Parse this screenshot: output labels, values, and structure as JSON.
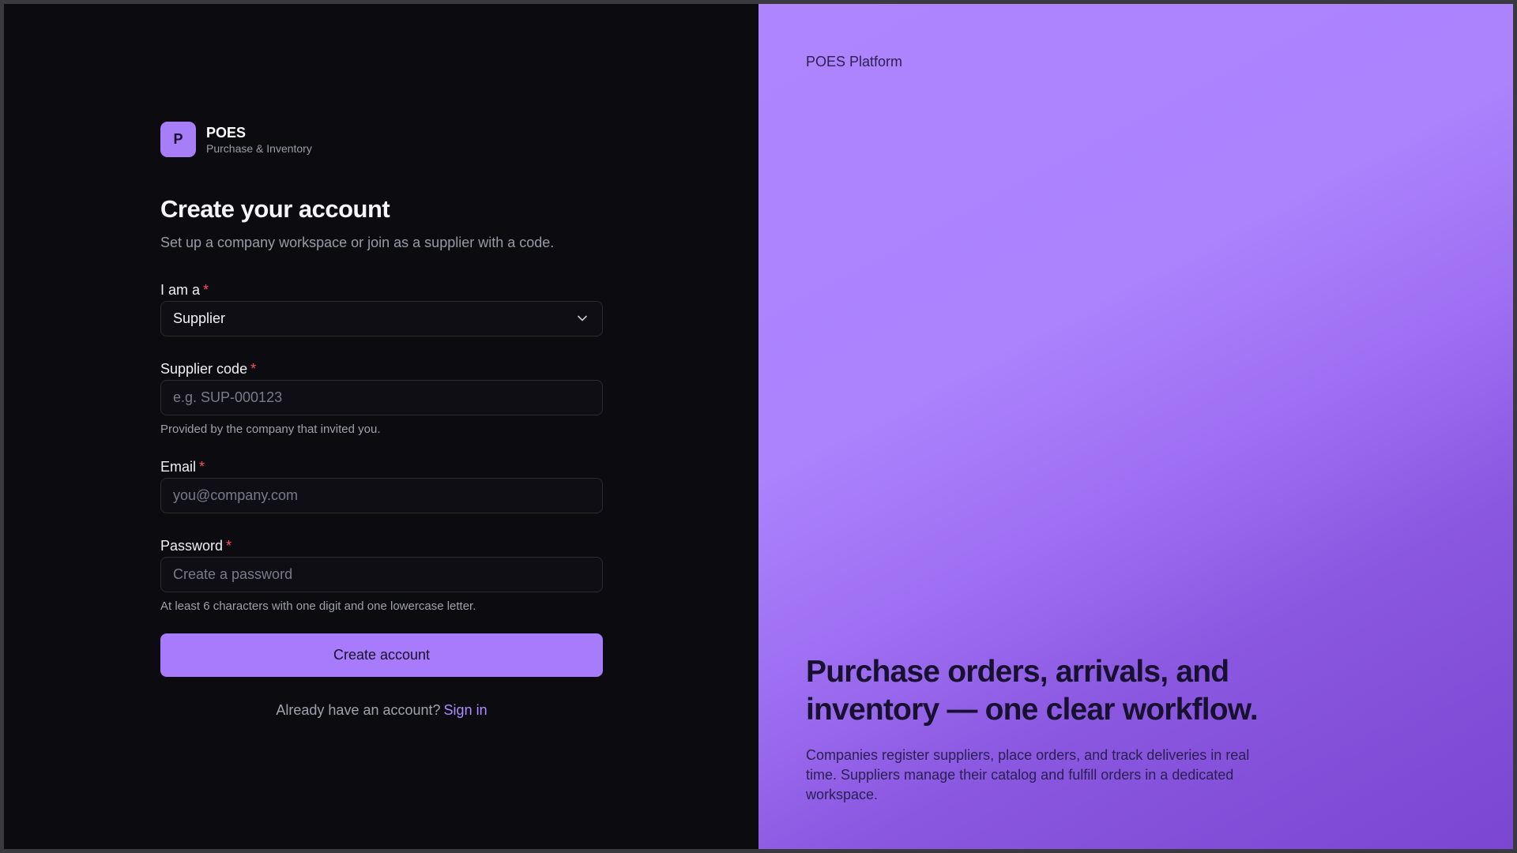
{
  "brand": {
    "logo_letter": "P",
    "name": "POES",
    "tagline": "Purchase & Inventory"
  },
  "form": {
    "title": "Create your account",
    "subtitle": "Set up a company workspace or join as a supplier with a code.",
    "role": {
      "label": "I am a",
      "required_mark": "*",
      "value": "Supplier"
    },
    "supplier_code": {
      "label": "Supplier code",
      "required_mark": "*",
      "placeholder": "e.g. SUP-000123",
      "hint": "Provided by the company that invited you."
    },
    "email": {
      "label": "Email",
      "required_mark": "*",
      "placeholder": "you@company.com"
    },
    "password": {
      "label": "Password",
      "required_mark": "*",
      "placeholder": "Create a password",
      "hint": "At least 6 characters with one digit and one lowercase letter."
    },
    "submit_label": "Create account",
    "signin_prompt": "Already have an account?",
    "signin_link": "Sign in"
  },
  "hero": {
    "platform_label": "POES Platform",
    "headline": "Purchase orders, arrivals, and inventory — one clear workflow.",
    "description": "Companies register suppliers, place orders, and track deliveries in real time. Suppliers manage their catalog and fulfill orders in a dedicated workspace."
  },
  "colors": {
    "accent": "#a77bfb",
    "left_background": "#0b0b10",
    "required": "#ff4d5e",
    "link": "#b08bff"
  },
  "icons": {
    "role_dropdown": "chevron-down-icon"
  }
}
